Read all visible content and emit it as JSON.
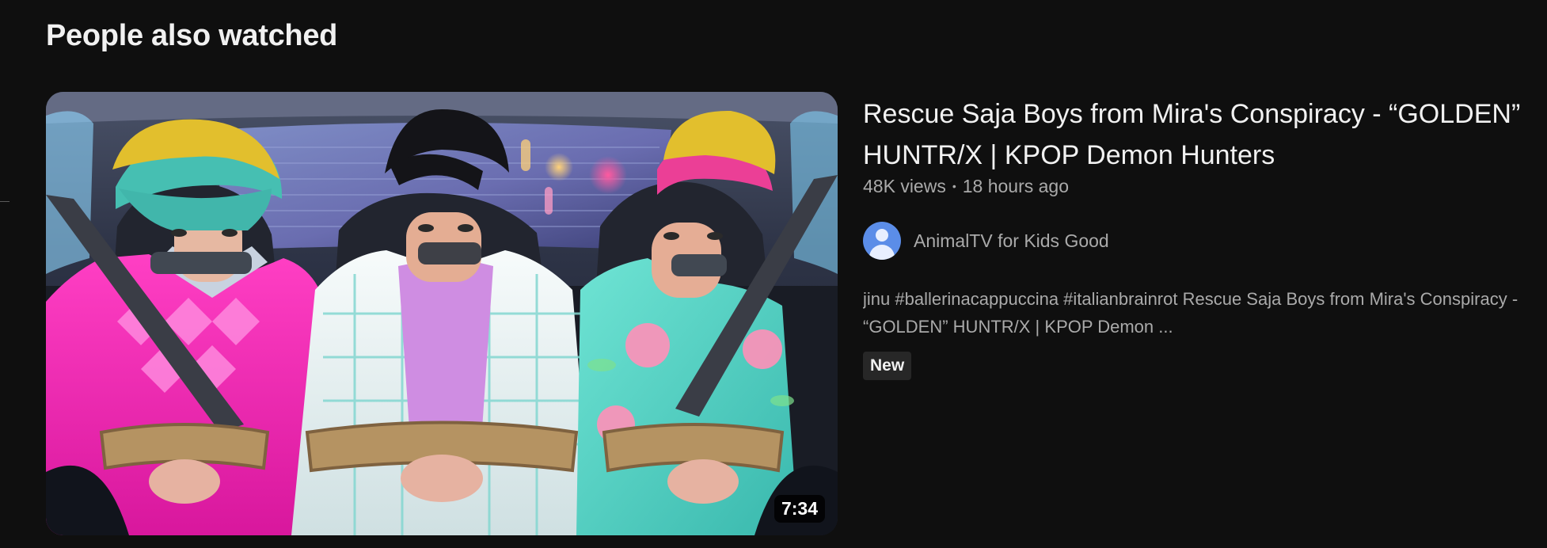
{
  "section": {
    "title": "People also watched"
  },
  "video": {
    "title": "Rescue Saja Boys from Mira's Conspiracy - “GOLDEN” HUNTR/X | KPOP Demon Hunters",
    "duration": "7:34",
    "views": "48K views",
    "separator": "•",
    "age": "18 hours ago",
    "channel": {
      "name": "AnimalTV for Kids Good",
      "avatar_icon": "default-user-avatar-icon",
      "avatar_color": "#5b8de8"
    },
    "description": "jinu #ballerinacappuccina #italianbrainrot Rescue Saja Boys from Mira's Conspiracy - “GOLDEN” HUNTR/X | KPOP Demon ...",
    "badge": "New"
  },
  "colors": {
    "background": "#0f0f0f",
    "primary_text": "#f1f1f1",
    "secondary_text": "#aaaaaa",
    "badge_background": "#272727"
  }
}
